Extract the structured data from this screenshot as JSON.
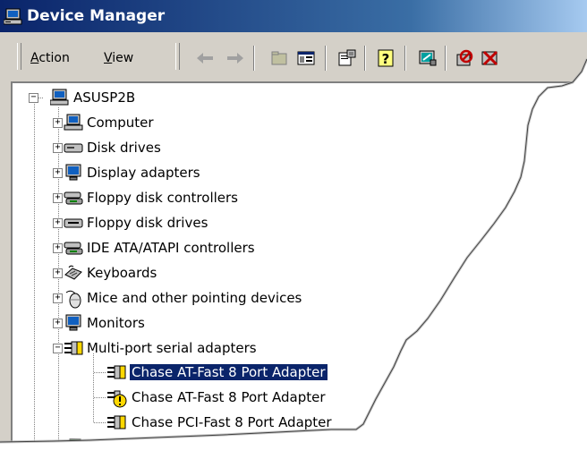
{
  "window": {
    "title": "Device Manager"
  },
  "menu": {
    "action": "Action",
    "view": "View"
  },
  "toolbar": {
    "buttons": [
      "back-arrow",
      "forward-arrow",
      "up-folder",
      "show-hide-tree",
      "properties",
      "help",
      "scan-hardware",
      "disable-device",
      "uninstall-device"
    ]
  },
  "tree": {
    "root": "ASUSP2B",
    "categories": [
      "Computer",
      "Disk drives",
      "Display adapters",
      "Floppy disk controllers",
      "Floppy disk drives",
      "IDE ATA/ATAPI controllers",
      "Keyboards",
      "Mice and other pointing devices",
      "Monitors",
      "Multi-port serial adapters"
    ],
    "devices": [
      "Chase AT-Fast 8 Port Adapter",
      "Chase AT-Fast 8 Port Adapter",
      "Chase PCI-Fast 8 Port Adapter"
    ]
  },
  "colors": {
    "titlebar": "#0a246a",
    "selection": "#0a246a",
    "warning": "#ffd800"
  }
}
